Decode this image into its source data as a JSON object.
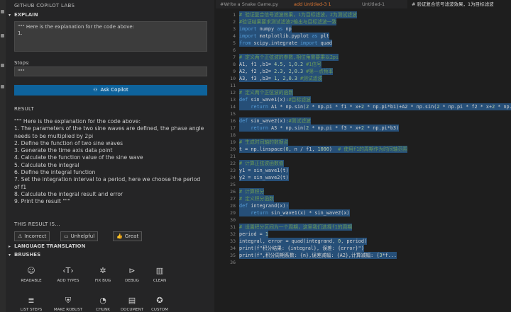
{
  "panel": {
    "title": "GITHUB COPILOT LABS",
    "explain_header": "EXPLAIN",
    "explain_text_line1": "\"\"\" Here is the explanation for the code above:",
    "explain_text_line2": "1.",
    "stops_label": "Stops:",
    "stops_value": "\"\"\"",
    "ask_button": "Ask Copilot",
    "result_header": "RESULT",
    "result_lines": [
      "\"\"\" Here is the explanation for the code above:",
      "1. The parameters of the two sine waves are defined, the phase angle",
      "needs to be multiplied by 2pi",
      "2. Define the function of two sine waves",
      "3. Generate the time axis data point",
      "4. Calculate the function value of the sine wave",
      "5. Calculate the integral",
      "6. Define the integral function",
      "7. Set the integration interval to a period, here we choose the period",
      "of f1",
      "8. Calculate the integral result and error",
      "9. Print the result \"\"\""
    ],
    "this_result_label": "THIS RESULT IS...",
    "feedback": [
      "Incorrect",
      "Unhelpful",
      "Great"
    ],
    "language_translation_header": "LANGUAGE TRANSLATION",
    "brushes_header": "BRUSHES",
    "brushes_row1": [
      "READABLE",
      "ADD TYPES",
      "FIX BUG",
      "DEBUG",
      "CLEAN"
    ],
    "brushes_row2": [
      "LIST STEPS",
      "MAKE ROBUST",
      "CHUNK",
      "DOCUMENT",
      "CUSTOM"
    ]
  },
  "editor": {
    "tabs": [
      {
        "label": "#Write a Snake Game.py",
        "active": false
      },
      {
        "label": "add  Untitled-3  1",
        "active": false
      },
      {
        "label": "Untitled-1",
        "active": false
      },
      {
        "label": "# 验证复合信号滤波效果，1为目标滤波",
        "active": true
      }
    ],
    "lines": [
      {
        "n": "1",
        "text": "# 验证复合信号滤波效果，1为目标滤波，2为测试滤波"
      },
      {
        "n": "2",
        "text": "#验证结果要求测试滤波2输出与目标滤波一致"
      },
      {
        "n": "3",
        "text": "import numpy as np"
      },
      {
        "n": "4",
        "text": "import matplotlib.pyplot as plt"
      },
      {
        "n": "5",
        "text": "from scipy.integrate import quad"
      },
      {
        "n": "6",
        "text": ""
      },
      {
        "n": "7",
        "text": "# 定义两个正弦波的参数,相位角需要乘以2pi"
      },
      {
        "n": "8",
        "text": "A1, f1 ,b1= 4.5, 1,0.2 #1信号"
      },
      {
        "n": "9",
        "text": "A2, f2 ,b2= 2.3, 2,0.3 #第一点频率"
      },
      {
        "n": "10",
        "text": "A3, f3 ,b3= 1, 2,0.3 #测试滤波"
      },
      {
        "n": "11",
        "text": ""
      },
      {
        "n": "12",
        "text": "# 定义两个正弦波的函数"
      },
      {
        "n": "13",
        "text": "def sin_wave1(x):#目标滤波"
      },
      {
        "n": "14",
        "text": "    return A1 * np.sin(2 * np.pi * f1 * x+2 * np.pi*b1)+A2 * np.sin(2 * np.pi * f2 * x+2 * np.pi*b2)"
      },
      {
        "n": "15",
        "text": ""
      },
      {
        "n": "16",
        "text": "def sin_wave2(x):#测试滤波"
      },
      {
        "n": "17",
        "text": "    return A3 * np.sin(2 * np.pi * f3 * x+2 * np.pi*b3)"
      },
      {
        "n": "18",
        "text": ""
      },
      {
        "n": "19",
        "text": "# 生成时间轴的数据点"
      },
      {
        "n": "20",
        "text": "t = np.linspace(0, n / f1, 1000)  # 使用f1的周期作为时间轴范围"
      },
      {
        "n": "21",
        "text": ""
      },
      {
        "n": "22",
        "text": "# 计算正弦波函数值"
      },
      {
        "n": "23",
        "text": "y1 = sin_wave1(t)"
      },
      {
        "n": "24",
        "text": "y2 = sin_wave2(t)"
      },
      {
        "n": "25",
        "text": ""
      },
      {
        "n": "26",
        "text": "# 计算积分"
      },
      {
        "n": "27",
        "text": "# 定义积分函数"
      },
      {
        "n": "28",
        "text": "def integrand(x):"
      },
      {
        "n": "29",
        "text": "    return sin_wave1(x) * sin_wave2(x)"
      },
      {
        "n": "30",
        "text": ""
      },
      {
        "n": "31",
        "text": "# 设置积分区间为一个周期，这里我们选择f1的周期"
      },
      {
        "n": "32",
        "text": "period = 1"
      },
      {
        "n": "33",
        "text": "integral, error = quad(integrand, 0, period)"
      },
      {
        "n": "34",
        "text": "print(f\"积分结果: {integral}, 误差: {error}\")"
      },
      {
        "n": "35",
        "text": "print(f\",积分周期系数: {n},误差减幅: {A2},计算减幅: {3*f..."
      },
      {
        "n": "36",
        "text": ""
      }
    ]
  },
  "colors": {
    "accent_button": "#0e639c",
    "selection": "#264f78",
    "comment": "#6a9955",
    "keyword": "#569cd6"
  }
}
